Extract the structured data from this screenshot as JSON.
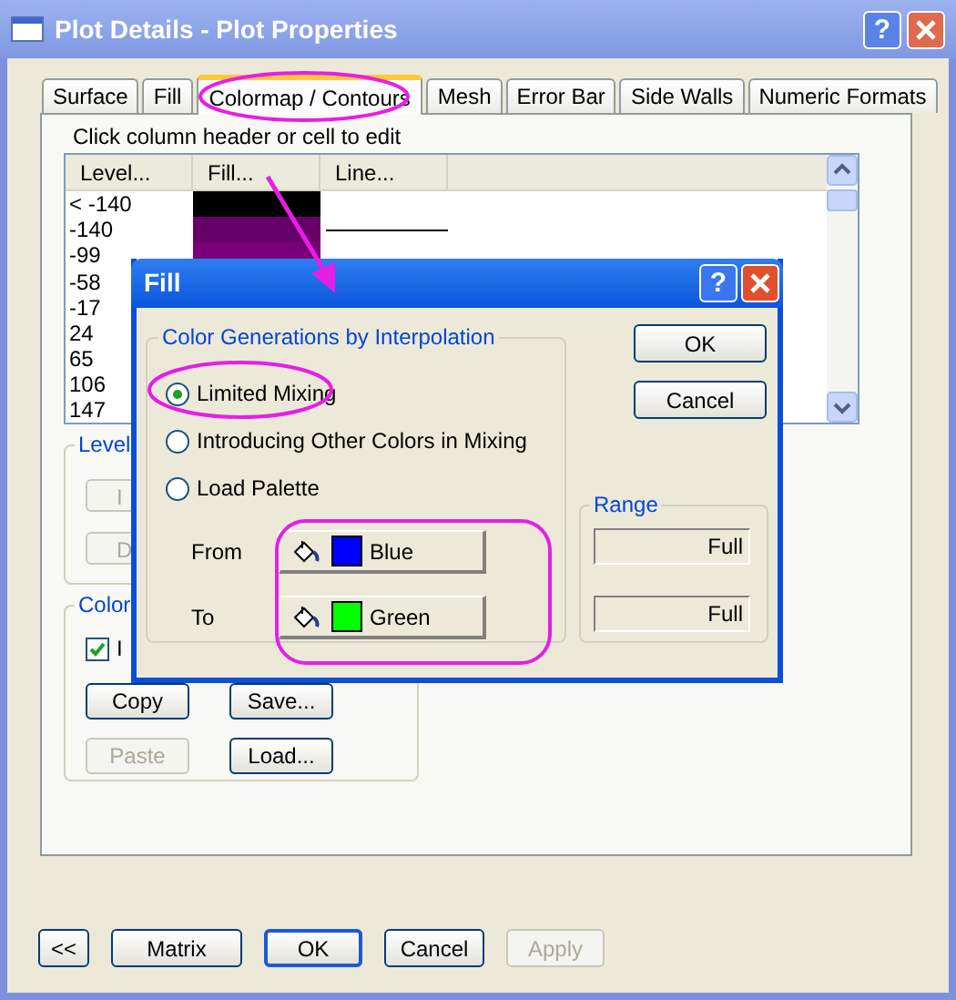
{
  "window": {
    "title": "Plot Details - Plot Properties",
    "help": "?"
  },
  "tabs": [
    {
      "label": "Surface",
      "selected": false
    },
    {
      "label": "Fill",
      "selected": false
    },
    {
      "label": "Colormap / Contours",
      "selected": true
    },
    {
      "label": "Mesh",
      "selected": false
    },
    {
      "label": "Error Bar",
      "selected": false
    },
    {
      "label": "Side Walls",
      "selected": false
    },
    {
      "label": "Numeric Formats",
      "selected": false
    }
  ],
  "hint": "Click column header or cell to edit",
  "table": {
    "columns": [
      "Level...",
      "Fill...",
      "Line..."
    ],
    "rows": [
      {
        "level": "< -140",
        "color": "#000000",
        "line": false
      },
      {
        "level": "-140",
        "color": "#690069",
        "line": true
      },
      {
        "level": "-99",
        "color": "#7a007a"
      },
      {
        "level": "-58"
      },
      {
        "level": "-17"
      },
      {
        "level": "24"
      },
      {
        "level": "65"
      },
      {
        "level": "106"
      },
      {
        "level": "147"
      }
    ]
  },
  "level_group": {
    "title": "Level",
    "buttons": [
      "I",
      "D"
    ]
  },
  "colormap_group": {
    "title": "Color",
    "checkbox": {
      "label": "I",
      "checked": true
    },
    "buttons": [
      {
        "label": "Copy",
        "disabled": false
      },
      {
        "label": "Save...",
        "disabled": false
      },
      {
        "label": "Paste",
        "disabled": true
      },
      {
        "label": "Load...",
        "disabled": false
      }
    ]
  },
  "footer_buttons": [
    {
      "label": "<<",
      "disabled": false,
      "default": false
    },
    {
      "label": "Matrix",
      "disabled": false,
      "default": false
    },
    {
      "label": "OK",
      "disabled": false,
      "default": true
    },
    {
      "label": "Cancel",
      "disabled": false,
      "default": false
    },
    {
      "label": "Apply",
      "disabled": true,
      "default": false
    }
  ],
  "fill_dialog": {
    "title": "Fill",
    "help": "?",
    "group_title": "Color Generations by Interpolation",
    "options": [
      {
        "label": "Limited Mixing",
        "selected": true
      },
      {
        "label": "Introducing Other Colors in Mixing",
        "selected": false
      },
      {
        "label": "Load Palette",
        "selected": false
      }
    ],
    "colors": [
      {
        "label": "From",
        "name": "Blue",
        "color": "#0000ff"
      },
      {
        "label": "To",
        "name": "Green",
        "color": "#00ff00"
      }
    ],
    "buttons": [
      "OK",
      "Cancel"
    ],
    "range": {
      "title": "Range",
      "fields": [
        "Full",
        "Full"
      ]
    }
  },
  "annotations": [
    {
      "kind": "ellipse"
    },
    {
      "kind": "arrow"
    },
    {
      "kind": "ellipse"
    },
    {
      "kind": "outline"
    }
  ]
}
